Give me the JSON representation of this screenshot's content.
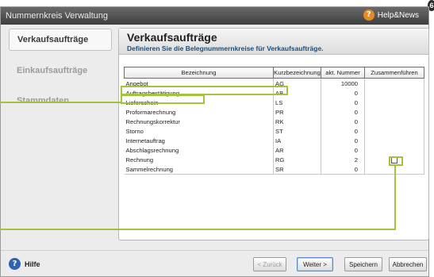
{
  "window": {
    "title": "Nummernkreis Verwaltung",
    "help_news": "Help&News",
    "help_glyph": "?",
    "badge": "6"
  },
  "sidebar": {
    "items": [
      {
        "label": "Verkaufsaufträge",
        "active": true
      },
      {
        "label": "Einkaufsaufträge",
        "active": false
      },
      {
        "label": "Stammdaten",
        "active": false
      }
    ]
  },
  "content": {
    "title": "Verkaufsaufträge",
    "subtitle": "Definieren Sie die Belegnummernkreise für Verkaufsaufträge."
  },
  "table": {
    "columns": [
      "Bezeichnung",
      "Kurzbezeichnung",
      "akt. Nummer",
      "Zusammenführen"
    ],
    "rows": [
      {
        "name": "Angebot",
        "short": "AG",
        "number": "10000",
        "merge": false
      },
      {
        "name": "Auftragsbestätigung",
        "short": "AB",
        "number": "0",
        "merge": false
      },
      {
        "name": "Lieferschein",
        "short": "LS",
        "number": "0",
        "merge": false
      },
      {
        "name": "Proformarechnung",
        "short": "PR",
        "number": "0",
        "merge": false
      },
      {
        "name": "Rechnungskorrektur",
        "short": "RK",
        "number": "0",
        "merge": false
      },
      {
        "name": "Storno",
        "short": "ST",
        "number": "0",
        "merge": false
      },
      {
        "name": "Internetauftrag",
        "short": "IA",
        "number": "0",
        "merge": false
      },
      {
        "name": "Abschlagsrechnung",
        "short": "AR",
        "number": "0",
        "merge": false
      },
      {
        "name": "Rechnung",
        "short": "RG",
        "number": "2",
        "merge": true
      },
      {
        "name": "Sammelrechnung",
        "short": "SR",
        "number": "0",
        "merge": false
      }
    ]
  },
  "footer": {
    "help_label": "Hilfe",
    "help_glyph": "?",
    "back_label": "< Zurück",
    "next_label": "Weiter >",
    "save_label": "Speichern",
    "cancel_label": "Abbrechen"
  },
  "colors": {
    "highlight": "#a3c33a",
    "title_bar": "#4a4a4a",
    "subtitle": "#1d4e7c"
  }
}
